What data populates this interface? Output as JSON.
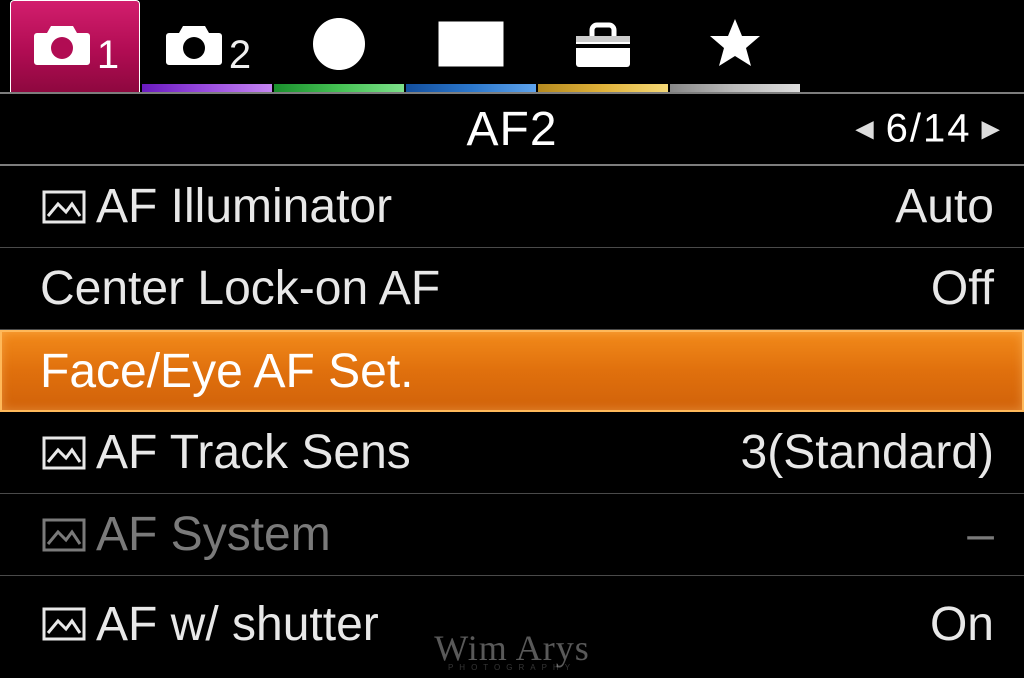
{
  "tabs": [
    {
      "name": "camera-1-tab",
      "icon": "camera-icon",
      "suffix": "1",
      "active": true
    },
    {
      "name": "camera-2-tab",
      "icon": "camera-icon",
      "suffix": "2",
      "active": false
    },
    {
      "name": "network-tab",
      "icon": "globe-icon",
      "suffix": "",
      "active": false
    },
    {
      "name": "playback-tab",
      "icon": "play-icon",
      "suffix": "",
      "active": false
    },
    {
      "name": "setup-tab",
      "icon": "toolbox-icon",
      "suffix": "",
      "active": false
    },
    {
      "name": "favorites-tab",
      "icon": "star-icon",
      "suffix": "",
      "active": false
    }
  ],
  "page": {
    "title": "AF2",
    "pager": "6/14"
  },
  "items": [
    {
      "name": "af-illuminator",
      "icon": true,
      "label": "AF Illuminator",
      "value": "Auto",
      "selected": false,
      "disabled": false
    },
    {
      "name": "center-lock-on-af",
      "icon": false,
      "label": "Center Lock-on AF",
      "value": "Off",
      "selected": false,
      "disabled": false
    },
    {
      "name": "face-eye-af-set",
      "icon": false,
      "label": "Face/Eye AF Set.",
      "value": "",
      "selected": true,
      "disabled": false
    },
    {
      "name": "af-track-sens",
      "icon": true,
      "label": "AF Track Sens",
      "value": "3(Standard)",
      "selected": false,
      "disabled": false
    },
    {
      "name": "af-system",
      "icon": true,
      "label": "AF System",
      "value": "–",
      "selected": false,
      "disabled": true
    },
    {
      "name": "af-w-shutter",
      "icon": true,
      "label": "AF w/ shutter",
      "value": "On",
      "selected": false,
      "disabled": false
    }
  ],
  "watermark": {
    "main": "Wim Arys",
    "sub": "PHOTOGRAPHY"
  }
}
